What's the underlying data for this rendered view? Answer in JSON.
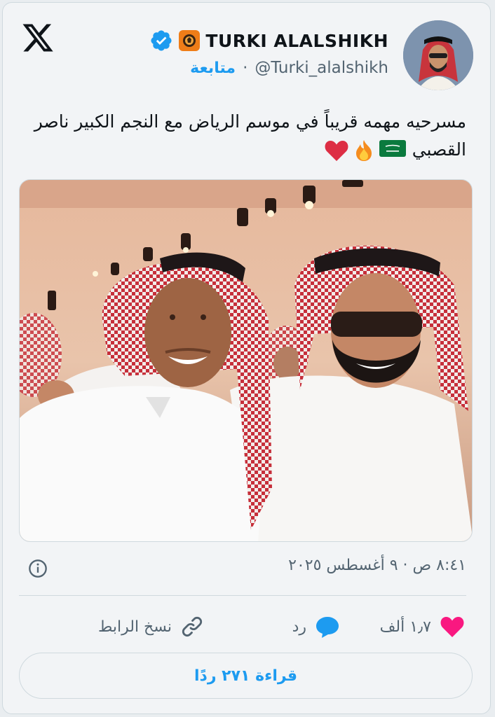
{
  "header": {
    "logo_icon": "x-logo-icon",
    "display_name": "TURKI ALALSHIKH",
    "verified_icon": "verified-badge-icon",
    "affiliation_icon": "organization-badge-icon",
    "handle": "@Turki_alalshikh",
    "separator": "·",
    "follow_label": "متابعة",
    "avatar_icon": "profile-avatar"
  },
  "tweet": {
    "text": "مسرحيه مهمه قريباً في موسم الرياض مع النجم الكبير ناصر القصبي",
    "emojis": [
      "saudi-flag-emoji",
      "fire-emoji",
      "red-heart-emoji"
    ],
    "media": "photo"
  },
  "meta": {
    "info_icon": "info-icon",
    "timestamp": "٨:٤١ ص · ٩ أغسطس ٢٠٢٥"
  },
  "actions": {
    "like_count": "١٫٧ ألف",
    "reply_label": "رد",
    "copy_link_label": "نسخ الرابط"
  },
  "read_replies_label": "قراءة ٢٧١ ردًا",
  "colors": {
    "accent": "#1d9bf0",
    "like": "#f91880",
    "text": "#0f1419",
    "muted": "#536471"
  }
}
